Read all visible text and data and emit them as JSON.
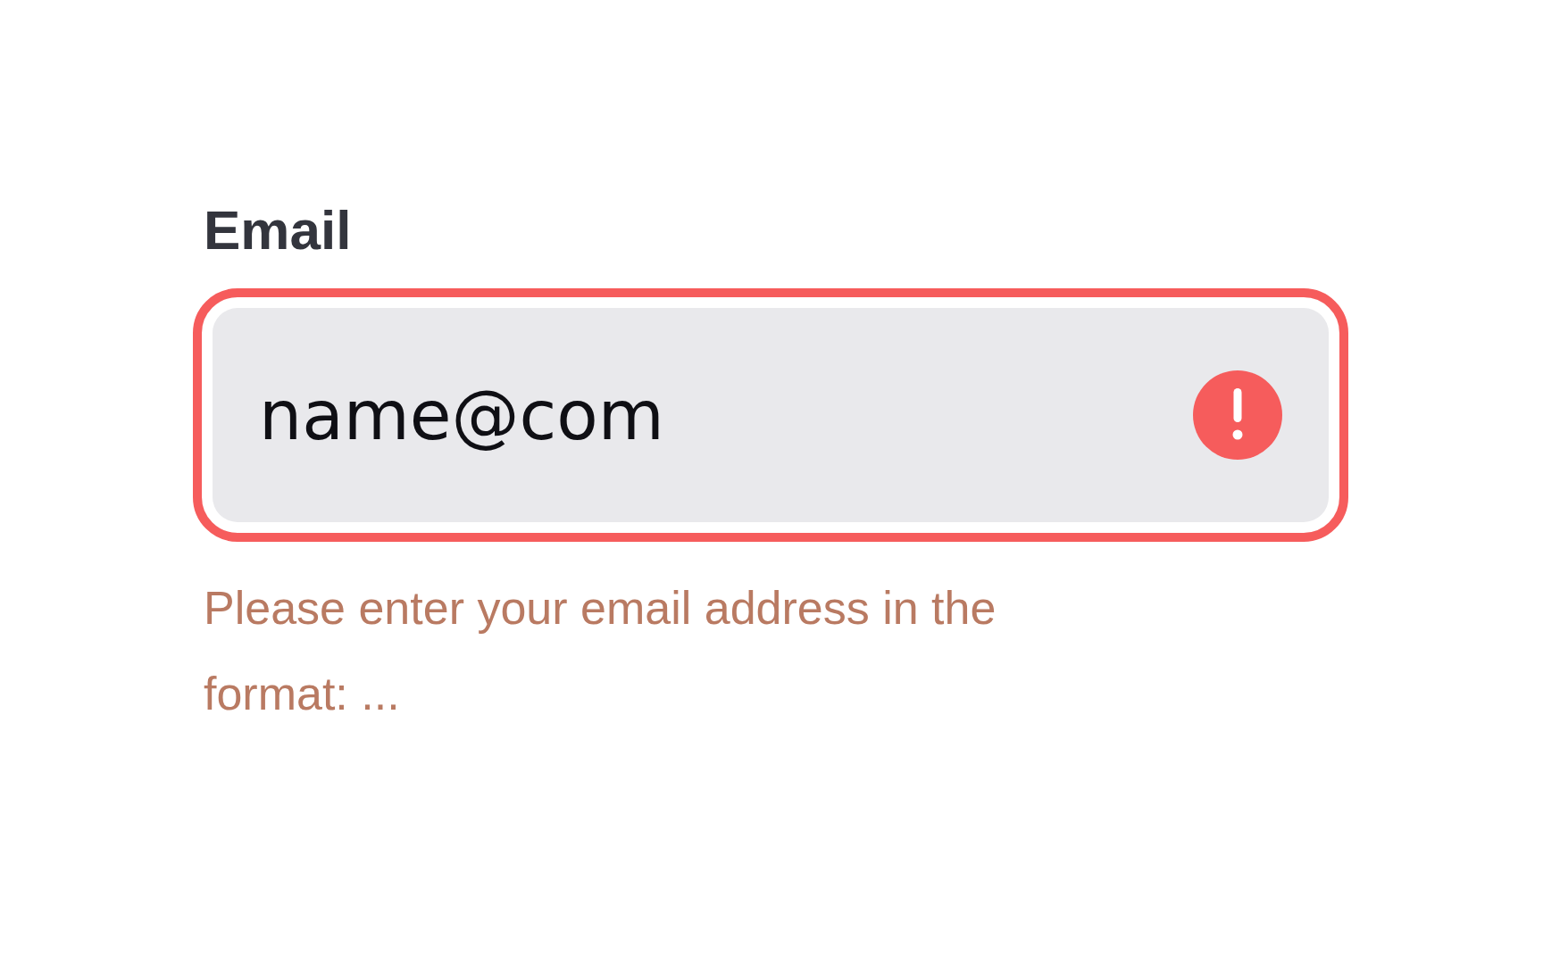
{
  "field": {
    "label": "Email",
    "value": "name@com",
    "invalid": true,
    "error": "Please enter your email address in the format: ..."
  }
}
